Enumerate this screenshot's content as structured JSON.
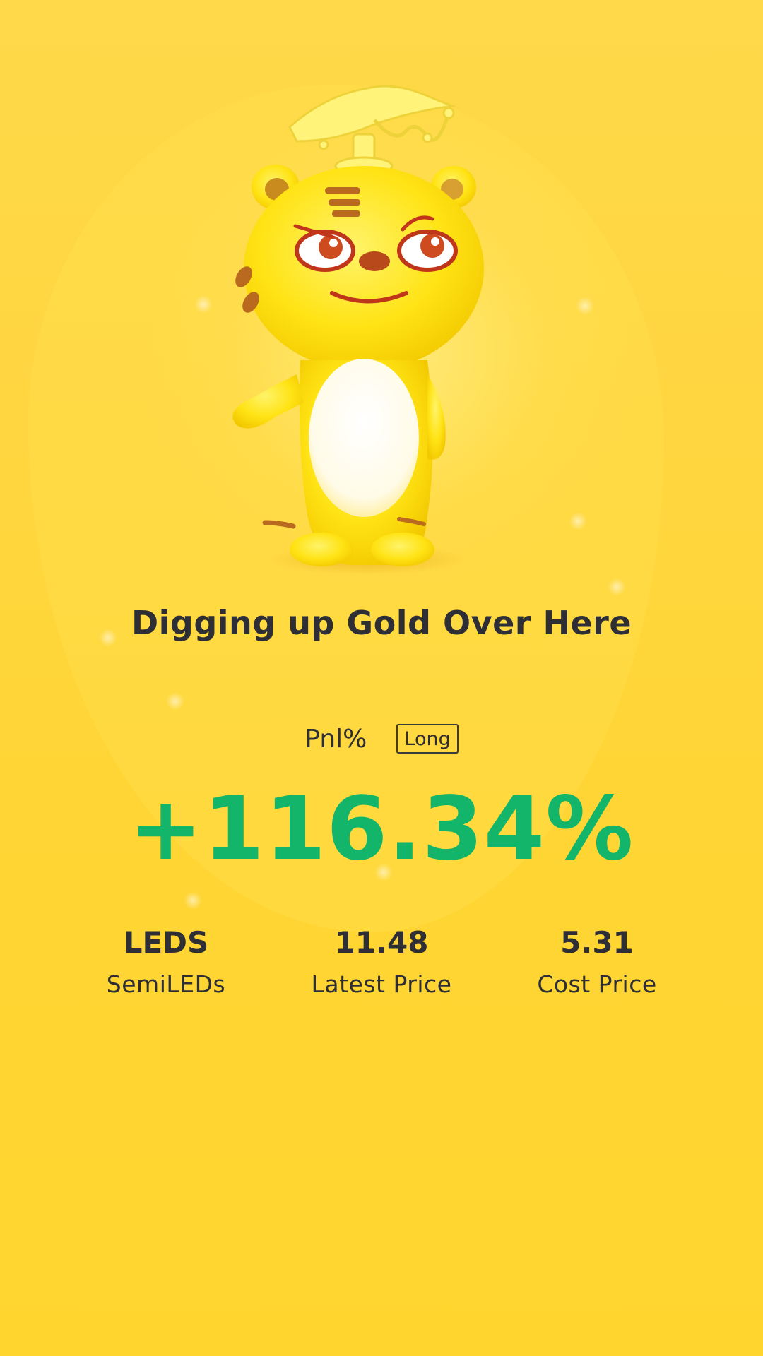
{
  "headline": "Digging up Gold Over Here",
  "pnl": {
    "label": "Pnl%",
    "direction": "Long",
    "value": "+116.34%"
  },
  "stats": [
    {
      "value": "LEDS",
      "label": "SemiLEDs"
    },
    {
      "value": "11.48",
      "label": "Latest Price"
    },
    {
      "value": "5.31",
      "label": "Cost Price"
    }
  ],
  "colors": {
    "background": "#ffd640",
    "text": "#2e2e36",
    "gain": "#12b56a"
  },
  "illustration": "tiger-mascot-with-lamp-hat"
}
